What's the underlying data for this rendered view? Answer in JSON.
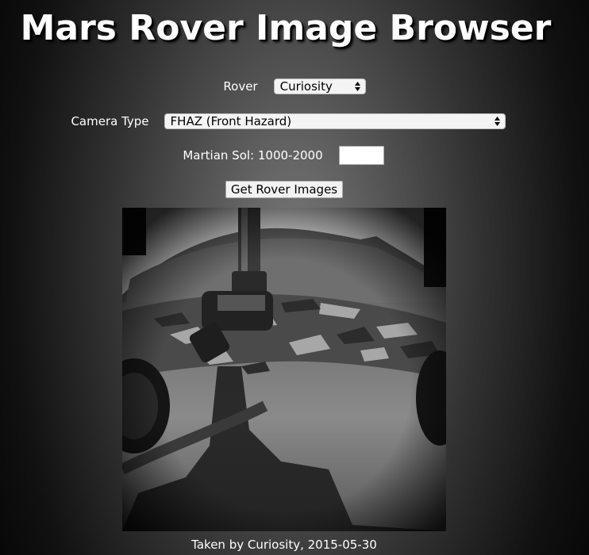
{
  "page": {
    "title": "Mars Rover Image Browser"
  },
  "form": {
    "rover_label": "Rover",
    "rover_selected": "Curiosity",
    "camera_label": "Camera Type",
    "camera_selected": "FHAZ (Front Hazard)",
    "sol_label": "Martian Sol: 1000-2000",
    "sol_value": "",
    "submit_label": "Get Rover Images"
  },
  "result": {
    "caption": "Taken by Curiosity, 2015-05-30",
    "image_description": "grayscale front hazard camera photo of rocky Martian terrain with rover arm and shadow"
  },
  "colors": {
    "background_center": "#7a7a7a",
    "background_edge": "#080808",
    "text": "#ffffff"
  }
}
